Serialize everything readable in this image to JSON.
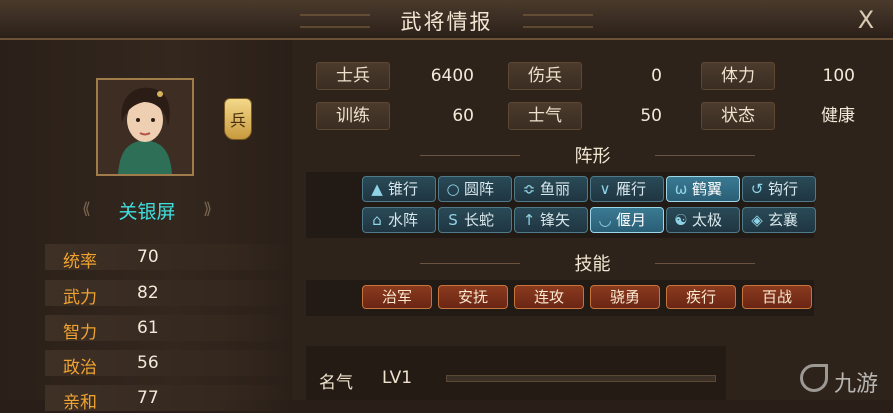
{
  "window": {
    "title": "武将情报",
    "close_label": "X"
  },
  "general": {
    "name": "关银屏",
    "troop_badge": "兵",
    "stats": [
      {
        "label": "统率",
        "value": "70"
      },
      {
        "label": "武力",
        "value": "82"
      },
      {
        "label": "智力",
        "value": "61"
      },
      {
        "label": "政治",
        "value": "56"
      },
      {
        "label": "亲和",
        "value": "77"
      }
    ]
  },
  "info": {
    "soldiers": {
      "label": "士兵",
      "value": "6400"
    },
    "wounded": {
      "label": "伤兵",
      "value": "0"
    },
    "stamina": {
      "label": "体力",
      "value": "100"
    },
    "training": {
      "label": "训练",
      "value": "60"
    },
    "morale": {
      "label": "士气",
      "value": "50"
    },
    "status": {
      "label": "状态",
      "value": "健康"
    }
  },
  "formation": {
    "title": "阵形",
    "items": [
      {
        "label": "锥行",
        "icon": "▲"
      },
      {
        "label": "圆阵",
        "icon": "○"
      },
      {
        "label": "鱼丽",
        "icon": "≎"
      },
      {
        "label": "雁行",
        "icon": "∨"
      },
      {
        "label": "鹤翼",
        "icon": "ѡ"
      },
      {
        "label": "钩行",
        "icon": "↺"
      },
      {
        "label": "水阵",
        "icon": "⌂"
      },
      {
        "label": "长蛇",
        "icon": "S"
      },
      {
        "label": "锋矢",
        "icon": "↑"
      },
      {
        "label": "偃月",
        "icon": "◡"
      },
      {
        "label": "太极",
        "icon": "☯"
      },
      {
        "label": "玄襄",
        "icon": "◈"
      }
    ],
    "active": [
      "鹤翼",
      "偃月"
    ]
  },
  "skills": {
    "title": "技能",
    "items": [
      "治军",
      "安抚",
      "连攻",
      "骁勇",
      "疾行",
      "百战"
    ]
  },
  "fame": {
    "label": "名气",
    "level": "LV1",
    "progress": 0
  },
  "watermark": {
    "text": "九游"
  },
  "colors": {
    "accent_cyan": "#3fe0df",
    "stat_label": "#f0a330",
    "skill_red": "#8a3a1e",
    "formation_blue": "#2a4a57"
  }
}
